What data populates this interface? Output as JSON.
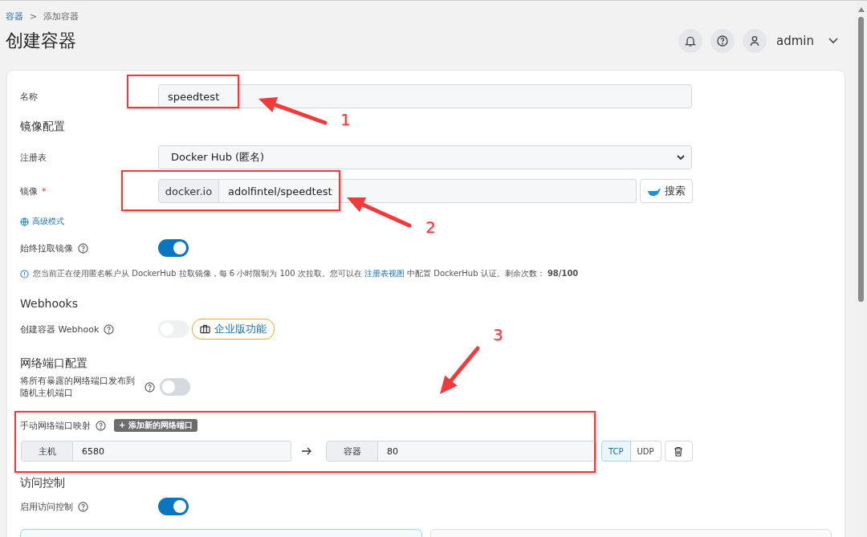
{
  "breadcrumb": {
    "parent": "容器",
    "separator": ">",
    "current": "添加容器"
  },
  "page_title": "创建容器",
  "user": {
    "name": "admin"
  },
  "name_field": {
    "label": "名称",
    "value": "speedtest"
  },
  "image_section": {
    "title": "镜像配置",
    "registry": {
      "label": "注册表",
      "value": "Docker Hub (匿名)"
    },
    "image": {
      "label": "镜像",
      "required_mark": "*",
      "prefix": "docker.io",
      "value": "adolfintel/speedtest",
      "search_button": "搜索"
    },
    "advanced_link": "高级模式",
    "always_pull": {
      "label": "始终拉取镜像",
      "on": true
    },
    "info": {
      "before": "您当前正在使用匿名帐户从 DockerHub 拉取镜像，每 6 小时限制为 100 次拉取。您可以在",
      "link": "注册表视图",
      "after": "中配置 DockerHub 认证。剩余次数： **98/100**"
    }
  },
  "webhooks": {
    "title": "Webhooks",
    "create_webhook": {
      "label": "创建容器 Webhook",
      "on": false,
      "disabled": true
    },
    "badge": "企业版功能"
  },
  "network": {
    "title": "网络端口配置",
    "publish_all": {
      "label": "将所有暴露的网络端口发布到随机主机端口",
      "on": false
    },
    "manual": {
      "label": "手动网络端口映射",
      "add_button": "+ 添加新的网络端口"
    },
    "mappings": [
      {
        "host_label": "主机",
        "host": "6580",
        "container_label": "容器",
        "container": "80",
        "protocols": [
          {
            "label": "TCP",
            "selected": true
          },
          {
            "label": "UDP",
            "selected": false
          }
        ]
      }
    ]
  },
  "access_control": {
    "title": "访问控制",
    "enable": {
      "label": "启用访问控制",
      "on": true
    },
    "options": [
      {
        "selected": true
      },
      {
        "selected": false
      }
    ]
  },
  "annotations": [
    {
      "number": "1"
    },
    {
      "number": "2"
    },
    {
      "number": "3"
    }
  ]
}
